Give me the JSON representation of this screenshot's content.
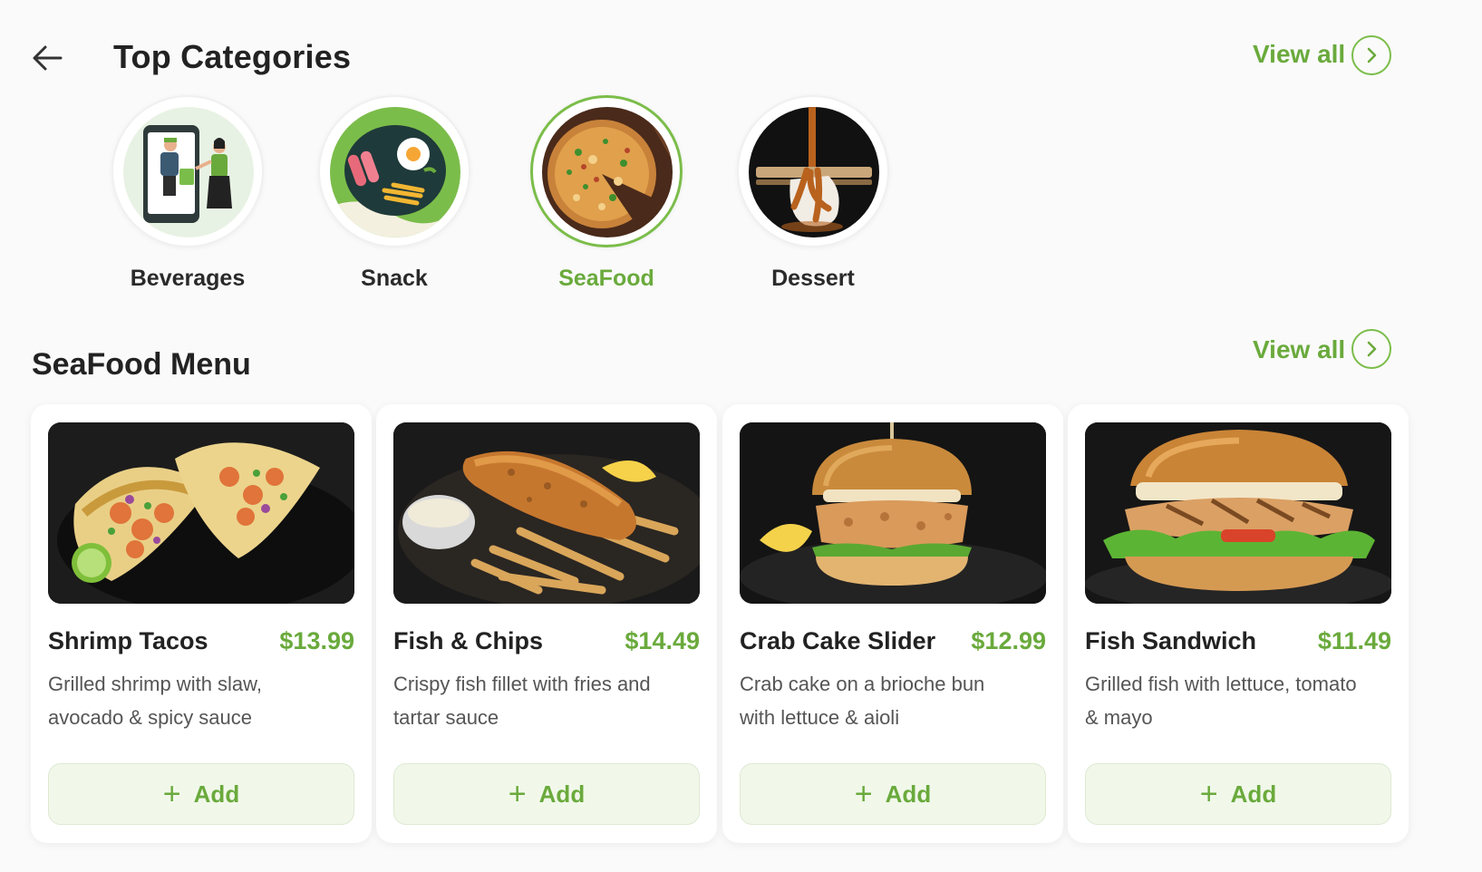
{
  "header": {
    "title": "Top Categories",
    "view_all": "View all",
    "back_icon": "arrow-left-icon"
  },
  "categories": [
    {
      "label": "Beverages",
      "active": false,
      "icon": "delivery-illustration"
    },
    {
      "label": "Snack",
      "active": false,
      "icon": "breakfast-plate-illustration"
    },
    {
      "label": "SeaFood",
      "active": true,
      "icon": "pizza-photo"
    },
    {
      "label": "Dessert",
      "active": false,
      "icon": "dessert-photo"
    }
  ],
  "menu": {
    "title": "SeaFood Menu",
    "view_all": "View all",
    "add_label": "Add",
    "items": [
      {
        "name": "Shrimp Tacos",
        "price": "$13.99",
        "description": "Grilled shrimp with slaw, avocado & spicy sauce"
      },
      {
        "name": "Fish & Chips",
        "price": "$14.49",
        "description": "Crispy fish fillet with fries and tartar sauce"
      },
      {
        "name": "Crab Cake Slider",
        "price": "$12.99",
        "description": "Crab cake on a brioche bun with lettuce & aioli"
      },
      {
        "name": "Fish Sandwich",
        "price": "$11.49",
        "description": "Grilled fish with lettuce, tomato & mayo"
      }
    ]
  },
  "colors": {
    "accent": "#6aaa3c",
    "accent_light": "#f1f8ea",
    "background": "#fafafa",
    "text": "#222222"
  }
}
